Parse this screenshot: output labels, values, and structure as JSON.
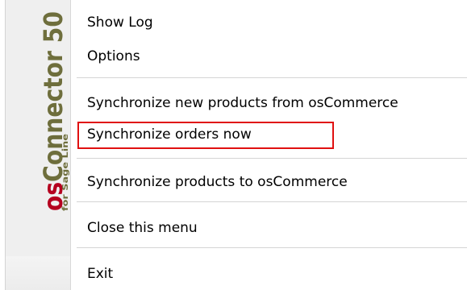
{
  "brand": {
    "name": "osConnector 50",
    "subtitle": "for Sage Line"
  },
  "menu": {
    "items": [
      {
        "id": "show-log",
        "label": "Show Log"
      },
      {
        "id": "options",
        "label": "Options"
      },
      {
        "id": "sync-new-products",
        "label": "Synchronize new products from osCommerce"
      },
      {
        "id": "sync-orders-now",
        "label": "Synchronize orders now",
        "highlighted": true
      },
      {
        "id": "sync-products-to",
        "label": "Synchronize products to osCommerce"
      },
      {
        "id": "close-menu",
        "label": "Close this menu"
      },
      {
        "id": "exit",
        "label": "Exit"
      }
    ]
  },
  "colors": {
    "brand_os": "#b5001f",
    "brand_connector": "#6e6e3c",
    "highlight_border": "#e01010"
  }
}
